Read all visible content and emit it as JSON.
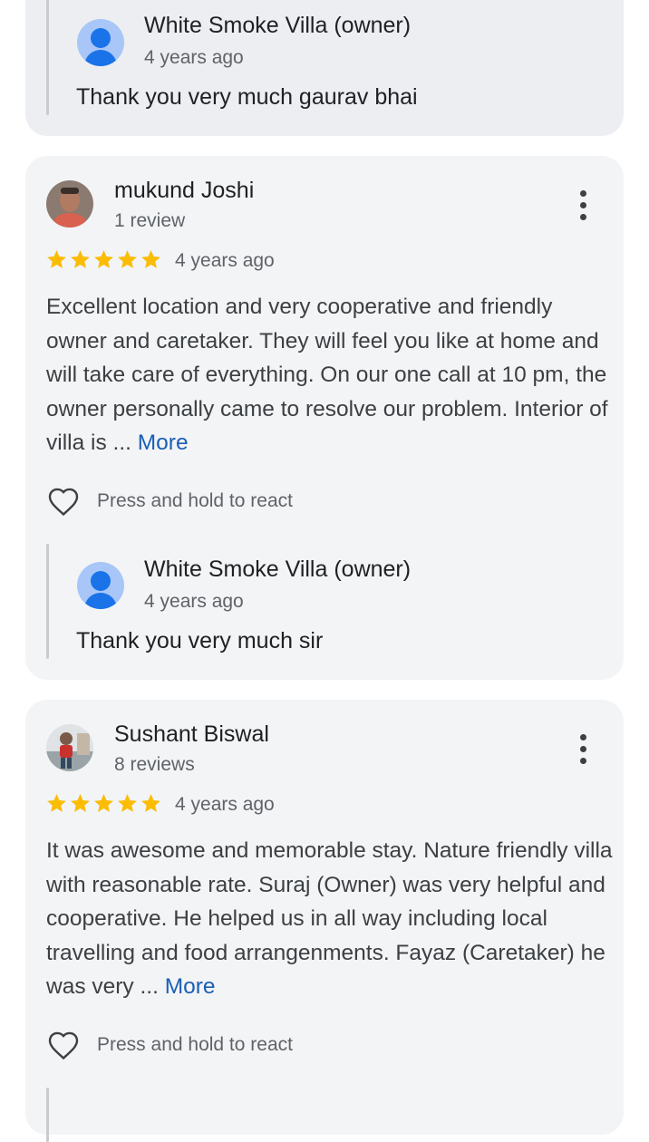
{
  "top_reply": {
    "owner_name": "White Smoke Villa (owner)",
    "time": "4 years ago",
    "text": "Thank you very much gaurav bhai"
  },
  "reviews": [
    {
      "name": "mukund Joshi",
      "reviews_count": "1 review",
      "rating": 5,
      "time": "4 years ago",
      "text": "Excellent location and very cooperative and friendly owner and caretaker. They will feel you like at home and will take care of everything. On our one call at 10 pm, the owner personally came to resolve our problem. Interior of villa is ...",
      "more_label": "More",
      "react_label": "Press and hold to react",
      "reply": {
        "owner_name": "White Smoke Villa (owner)",
        "time": "4 years ago",
        "text": "Thank you very much sir"
      }
    },
    {
      "name": "Sushant Biswal",
      "reviews_count": "8 reviews",
      "rating": 5,
      "time": "4 years ago",
      "text": "It was awesome and memorable stay. Nature friendly villa with reasonable rate. Suraj (Owner) was very helpful and cooperative. He helped us in all way including local travelling and food arrangenments. Fayaz (Caretaker) he was very ...",
      "more_label": "More",
      "react_label": "Press and hold to react"
    }
  ],
  "colors": {
    "star": "#fbbc04",
    "link": "#1a5fb4",
    "card_bg": "#f3f4f6"
  },
  "icons": [
    "person-icon",
    "star-icon",
    "heart-outline-icon",
    "more-vert-icon"
  ]
}
